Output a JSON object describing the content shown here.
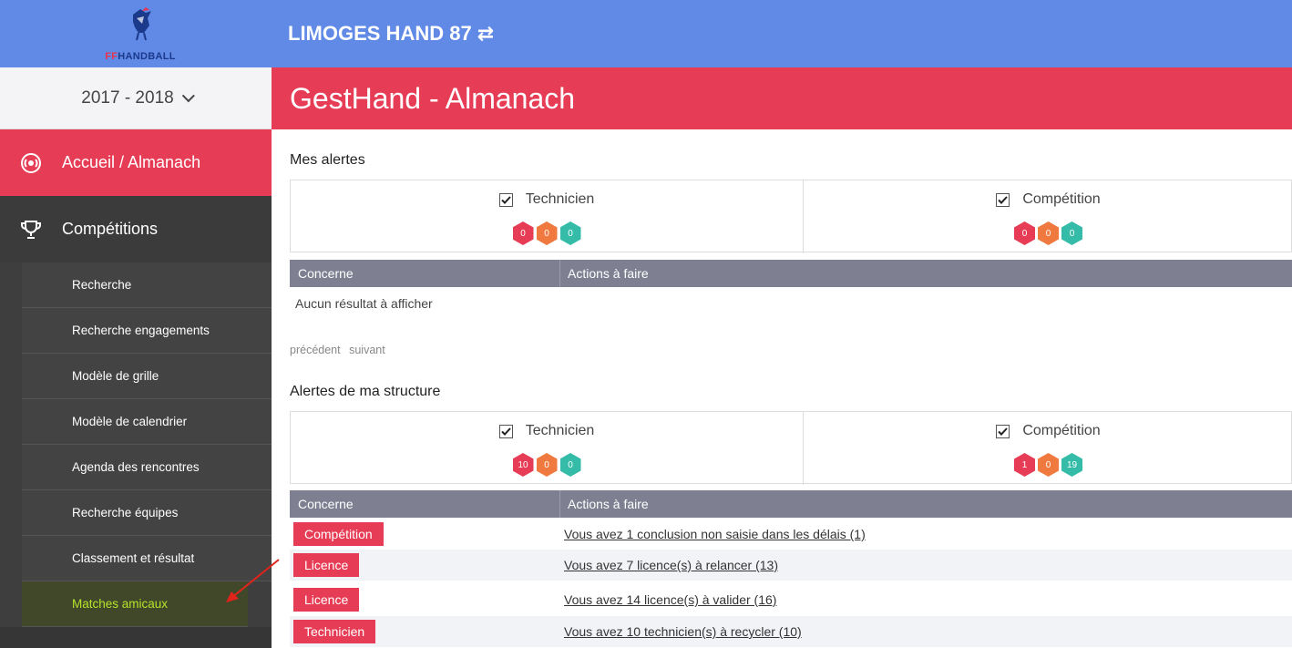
{
  "logo": {
    "text_ff": "FF",
    "text_hb": "HANDBALL"
  },
  "season": {
    "label": "2017 - 2018"
  },
  "sidebar": {
    "main_items": [
      {
        "label": "Accueil / Almanach",
        "icon": "radio-broadcast-icon"
      },
      {
        "label": "Compétitions",
        "icon": "trophy-icon"
      }
    ],
    "sub_items": [
      {
        "label": "Recherche"
      },
      {
        "label": "Recherche engagements"
      },
      {
        "label": "Modèle de grille"
      },
      {
        "label": "Modèle de calendrier"
      },
      {
        "label": "Agenda des rencontres"
      },
      {
        "label": "Recherche équipes"
      },
      {
        "label": "Classement et résultat"
      },
      {
        "label": "Matches amicaux"
      }
    ]
  },
  "topbar": {
    "club": "LIMOGES HAND 87",
    "swap_icon": "⇄"
  },
  "page": {
    "title": "GestHand - Almanach"
  },
  "my_alerts": {
    "title": "Mes alertes",
    "technicien": {
      "label": "Technicien",
      "badges": [
        "0",
        "0",
        "0"
      ]
    },
    "competition": {
      "label": "Compétition",
      "badges": [
        "0",
        "0",
        "0"
      ]
    },
    "table": {
      "col1": "Concerne",
      "col2": "Actions à faire"
    },
    "empty": "Aucun résultat à afficher",
    "pager": {
      "prev": "précédent",
      "next": "suivant"
    }
  },
  "structure_alerts": {
    "title": "Alertes de ma structure",
    "technicien": {
      "label": "Technicien",
      "badges": [
        "10",
        "0",
        "0"
      ]
    },
    "competition": {
      "label": "Compétition",
      "badges": [
        "1",
        "0",
        "19"
      ]
    },
    "table": {
      "col1": "Concerne",
      "col2": "Actions à faire"
    },
    "rows": [
      {
        "tag": "Compétition",
        "action": "Vous avez 1 conclusion non saisie dans les délais (1)"
      },
      {
        "tag": "Licence",
        "action": "Vous avez 7 licence(s) à relancer (13)"
      },
      {
        "tag": "Licence",
        "action": "Vous avez 14 licence(s) à valider (16)"
      },
      {
        "tag": "Technicien",
        "action": "Vous avez 10 technicien(s) à recycler (10)"
      }
    ]
  },
  "colors": {
    "brand_blue": "#6189e6",
    "brand_red": "#e73c55",
    "badge_orange": "#f0793f",
    "badge_teal": "#35bca8",
    "active_green": "#b6e42b"
  }
}
